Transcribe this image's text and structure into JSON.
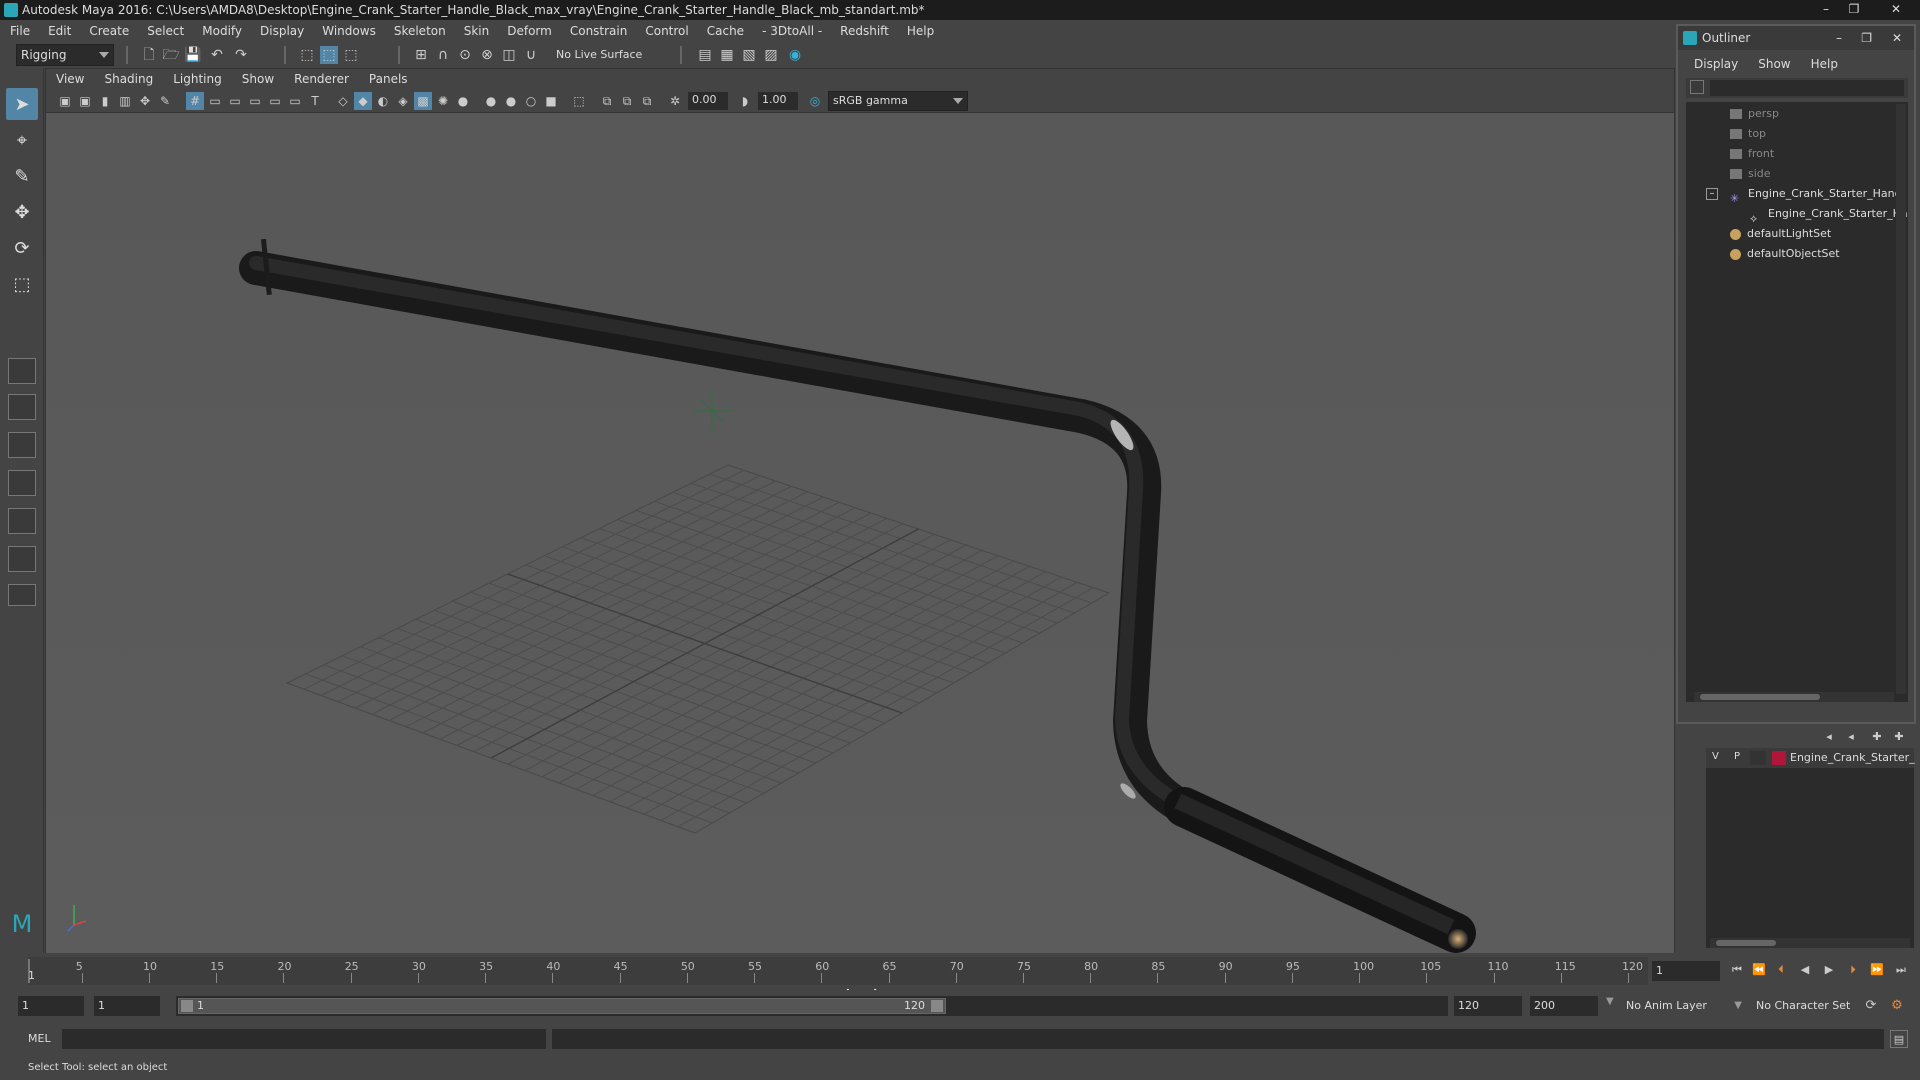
{
  "window": {
    "title": "Autodesk Maya 2016: C:\\Users\\AMDA8\\Desktop\\Engine_Crank_Starter_Handle_Black_max_vray\\Engine_Crank_Starter_Handle_Black_mb_standart.mb*"
  },
  "menubar": [
    "File",
    "Edit",
    "Create",
    "Select",
    "Modify",
    "Display",
    "Windows",
    "Skeleton",
    "Skin",
    "Deform",
    "Constrain",
    "Control",
    "Cache",
    "- 3DtoAll -",
    "Redshift",
    "Help"
  ],
  "statusline": {
    "menuset": "Rigging",
    "live_surface": "No Live Surface"
  },
  "viewport": {
    "menu": [
      "View",
      "Shading",
      "Lighting",
      "Show",
      "Renderer",
      "Panels"
    ],
    "exposure": "0.00",
    "gamma": "1.00",
    "color_space": "sRGB gamma",
    "camera_label": "persp"
  },
  "outliner": {
    "title": "Outliner",
    "menu": [
      "Display",
      "Show",
      "Help"
    ],
    "items": [
      {
        "label": "persp",
        "type": "camera"
      },
      {
        "label": "top",
        "type": "camera"
      },
      {
        "label": "front",
        "type": "camera"
      },
      {
        "label": "side",
        "type": "camera"
      },
      {
        "label": "Engine_Crank_Starter_Handl",
        "type": "group"
      },
      {
        "label": "Engine_Crank_Starter_Ha",
        "type": "mesh"
      },
      {
        "label": "defaultLightSet",
        "type": "set"
      },
      {
        "label": "defaultObjectSet",
        "type": "set"
      }
    ]
  },
  "layers": {
    "visible": "V",
    "playback": "P",
    "layer_name": "Engine_Crank_Starter_",
    "layer_color": "#b0153a"
  },
  "timeline": {
    "ticks": [
      "5",
      "10",
      "15",
      "20",
      "25",
      "30",
      "35",
      "40",
      "45",
      "50",
      "55",
      "60",
      "65",
      "70",
      "75",
      "80",
      "85",
      "90",
      "95",
      "100",
      "105",
      "110",
      "115",
      "120"
    ],
    "start_marker": "1",
    "current_frame": "1"
  },
  "range": {
    "start": "1",
    "playback_start": "1",
    "slider_start": "1",
    "slider_end": "120",
    "playback_end": "120",
    "end": "200",
    "anim_layer": "No Anim Layer",
    "character_set": "No Character Set"
  },
  "cmdline": {
    "mode": "MEL"
  },
  "helpline": "Select Tool: select an object"
}
